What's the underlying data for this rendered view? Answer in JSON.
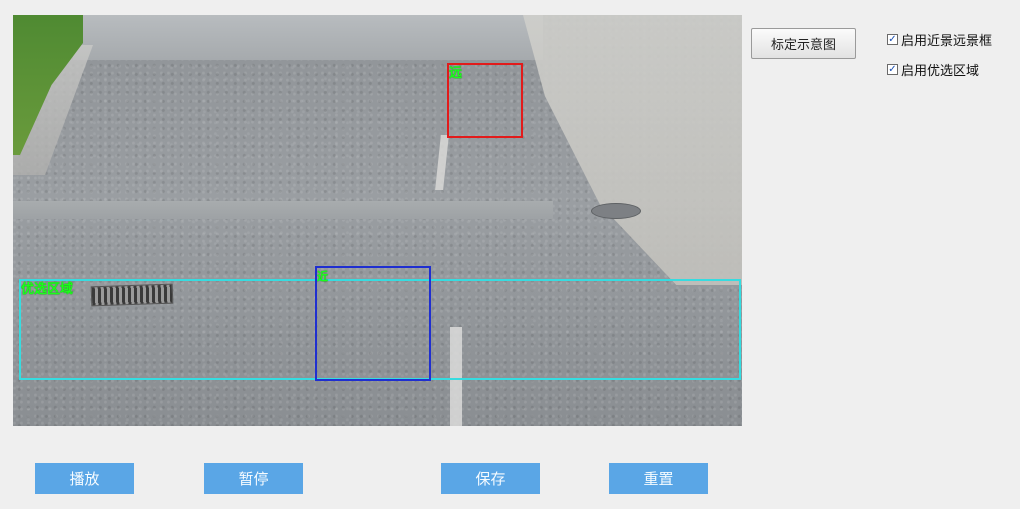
{
  "video": {
    "far_label": "远",
    "near_label": "近",
    "preferred_label": "优选区域"
  },
  "sidebar": {
    "calib_button_label": "标定示意图",
    "checkboxes": [
      {
        "label": "启用近景远景框",
        "checked": true,
        "mark": "✓"
      },
      {
        "label": "启用优选区域",
        "checked": true,
        "mark": "✓"
      }
    ]
  },
  "footer": {
    "play_label": "播放",
    "pause_label": "暂停",
    "save_label": "保存",
    "reset_label": "重置"
  },
  "colors": {
    "far_box": "#e21b1b",
    "near_box": "#1f2fd0",
    "preferred_box": "#36dce0",
    "label_text": "#1aff1a",
    "button_bg": "#5aa6e6"
  }
}
